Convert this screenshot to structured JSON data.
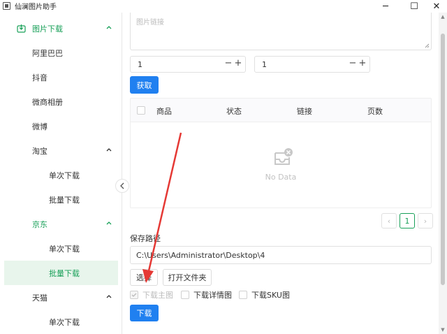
{
  "window": {
    "title": "仙澜图片助手",
    "controls": {
      "minimize": "─",
      "maximize": "☐",
      "close": "✕"
    }
  },
  "sidebar": {
    "top_group": {
      "label": "图片下载",
      "icon": "download-icon"
    },
    "items": [
      {
        "label": "阿里巴巴"
      },
      {
        "label": "抖音"
      },
      {
        "label": "微商相册"
      },
      {
        "label": "微博"
      },
      {
        "label": "淘宝"
      },
      {
        "label": "单次下载"
      },
      {
        "label": "批量下载"
      },
      {
        "label": "京东"
      },
      {
        "label": "单次下载"
      },
      {
        "label": "批量下载"
      },
      {
        "label": "天猫"
      },
      {
        "label": "单次下载"
      }
    ]
  },
  "main": {
    "link_input": {
      "placeholder": "图片链接"
    },
    "start_page": {
      "value": "1",
      "minus": "−",
      "plus": "+"
    },
    "end_page": {
      "value": "1",
      "minus": "−",
      "plus": "+"
    },
    "fetch_button": "获取",
    "table": {
      "columns": [
        "商品",
        "状态",
        "链接",
        "页数"
      ],
      "empty_text": "No Data"
    },
    "pagination": {
      "prev": "‹",
      "current": "1",
      "next": "›"
    },
    "save_path": {
      "label": "保存路径",
      "value": "C:\\Users\\Administrator\\Desktop\\4"
    },
    "choose_button": "选择",
    "open_folder_button": "打开文件夹",
    "options": [
      {
        "label": "下载主图",
        "checked": true,
        "disabled": true
      },
      {
        "label": "下载详情图",
        "checked": false,
        "disabled": false
      },
      {
        "label": "下载SKU图",
        "checked": false,
        "disabled": false
      }
    ],
    "download_button": "下载"
  },
  "colors": {
    "accent_green": "#18a058",
    "primary_blue": "#2080f0",
    "annotation_red": "#e53935"
  }
}
